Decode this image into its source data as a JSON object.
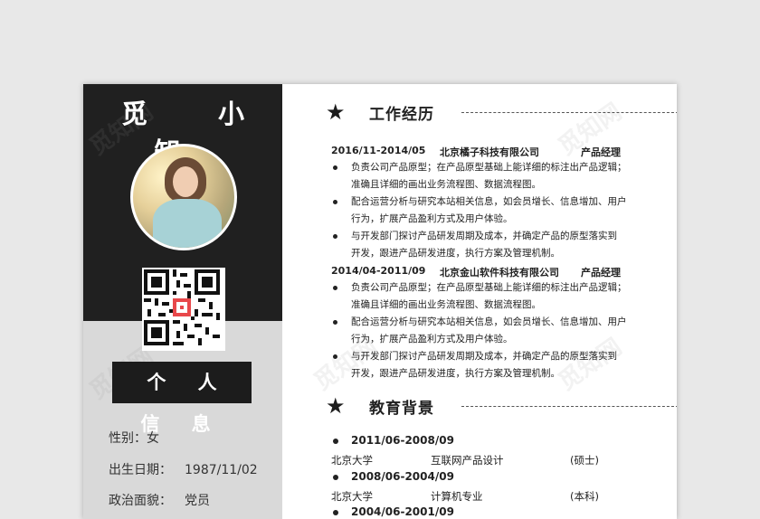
{
  "profile": {
    "name": "觅 小 知",
    "info_heading": "个 人 信 息",
    "fields": [
      {
        "label": "性别：",
        "value": "女"
      },
      {
        "label": "出生日期：",
        "value": "1987/11/02"
      },
      {
        "label": "政治面貌：",
        "value": "党员"
      }
    ]
  },
  "watermark": "觅知网",
  "work": {
    "title": "工作经历",
    "jobs": [
      {
        "dates": "2016/11-2014/05",
        "company": "北京橘子科技有限公司",
        "position": "产品经理",
        "bullets": [
          [
            "负责公司产品原型；在产品原型基础上能详细的标注出产品逻辑；",
            "准确且详细的画出业务流程图、数据流程图。"
          ],
          [
            "配合运营分析与研究本站相关信息，如会员增长、信息增加、用户",
            "行为，扩展产品盈利方式及用户体验。"
          ],
          [
            "与开发部门探讨产品研发周期及成本，并确定产品的原型落实到",
            "开发，跟进产品研发进度，执行方案及管理机制。"
          ]
        ]
      },
      {
        "dates": "2014/04-2011/09",
        "company": "北京金山软件科技有限公司",
        "position": "产品经理",
        "bullets": [
          [
            "负责公司产品原型；在产品原型基础上能详细的标注出产品逻辑；",
            "准确且详细的画出业务流程图、数据流程图。"
          ],
          [
            "配合运营分析与研究本站相关信息，如会员增长、信息增加、用户",
            "行为，扩展产品盈利方式及用户体验。"
          ],
          [
            "与开发部门探讨产品研发周期及成本，并确定产品的原型落实到",
            "开发，跟进产品研发进度，执行方案及管理机制。"
          ]
        ]
      }
    ]
  },
  "education": {
    "title": "教育背景",
    "entries": [
      {
        "dates": "2011/06-2008/09",
        "school": "北京大学",
        "major": "互联网产品设计",
        "degree": "(硕士)"
      },
      {
        "dates": "2008/06-2004/09",
        "school": "北京大学",
        "major": "计算机专业",
        "degree": "(本科)"
      },
      {
        "dates": "2004/06-2001/09"
      }
    ]
  }
}
